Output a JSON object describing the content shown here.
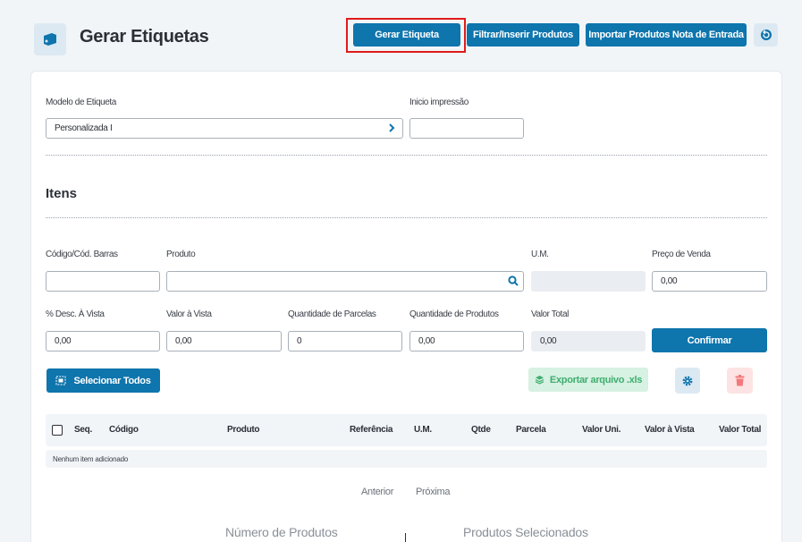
{
  "header": {
    "title": "Gerar Etiquetas",
    "generate_label": "Gerar Etiqueta",
    "filter_label": "Filtrar/Inserir Produtos",
    "import_label": "Importar Produtos Nota de Entrada"
  },
  "form": {
    "model_label": "Modelo de Etiqueta",
    "model_value": "Personalizada I",
    "start_label": "Inicio impressão",
    "start_value": ""
  },
  "items": {
    "title": "Itens",
    "code_label": "Código/Cód. Barras",
    "code_value": "",
    "product_label": "Produto",
    "product_value": "",
    "um_label": "U.M.",
    "um_value": "",
    "price_label": "Preço de Venda",
    "price_value": "0,00",
    "disc_label": "% Desc. À Vista",
    "disc_value": "0,00",
    "cash_label": "Valor à Vista",
    "cash_value": "0,00",
    "parcels_label": "Quantidade de Parcelas",
    "parcels_value": "0",
    "qty_label": "Quantidade de Produtos",
    "qty_value": "0,00",
    "total_label": "Valor Total",
    "total_value": "0,00",
    "confirm_label": "Confirmar",
    "select_all_label": "Selecionar Todos",
    "export_label": "Exportar arquivo .xls"
  },
  "table": {
    "columns": [
      "Seq.",
      "Código",
      "Produto",
      "Referência",
      "U.M.",
      "Qtde",
      "Parcela",
      "Valor Uni.",
      "Valor à Vista",
      "Valor Total"
    ],
    "empty_message": "Nenhum item adicionado"
  },
  "pagination": {
    "prev": "Anterior",
    "next": "Próxima"
  },
  "stats": {
    "products_count_label": "Número de Produtos",
    "selected_label": "Produtos Selecionados"
  },
  "colors": {
    "primary": "#0e75ad",
    "highlight": "#e01b1b",
    "export_bg": "#d7f1e2",
    "export_text": "#3fae6f",
    "delete_bg": "#fde3e3",
    "delete_icon": "#f2797b"
  }
}
